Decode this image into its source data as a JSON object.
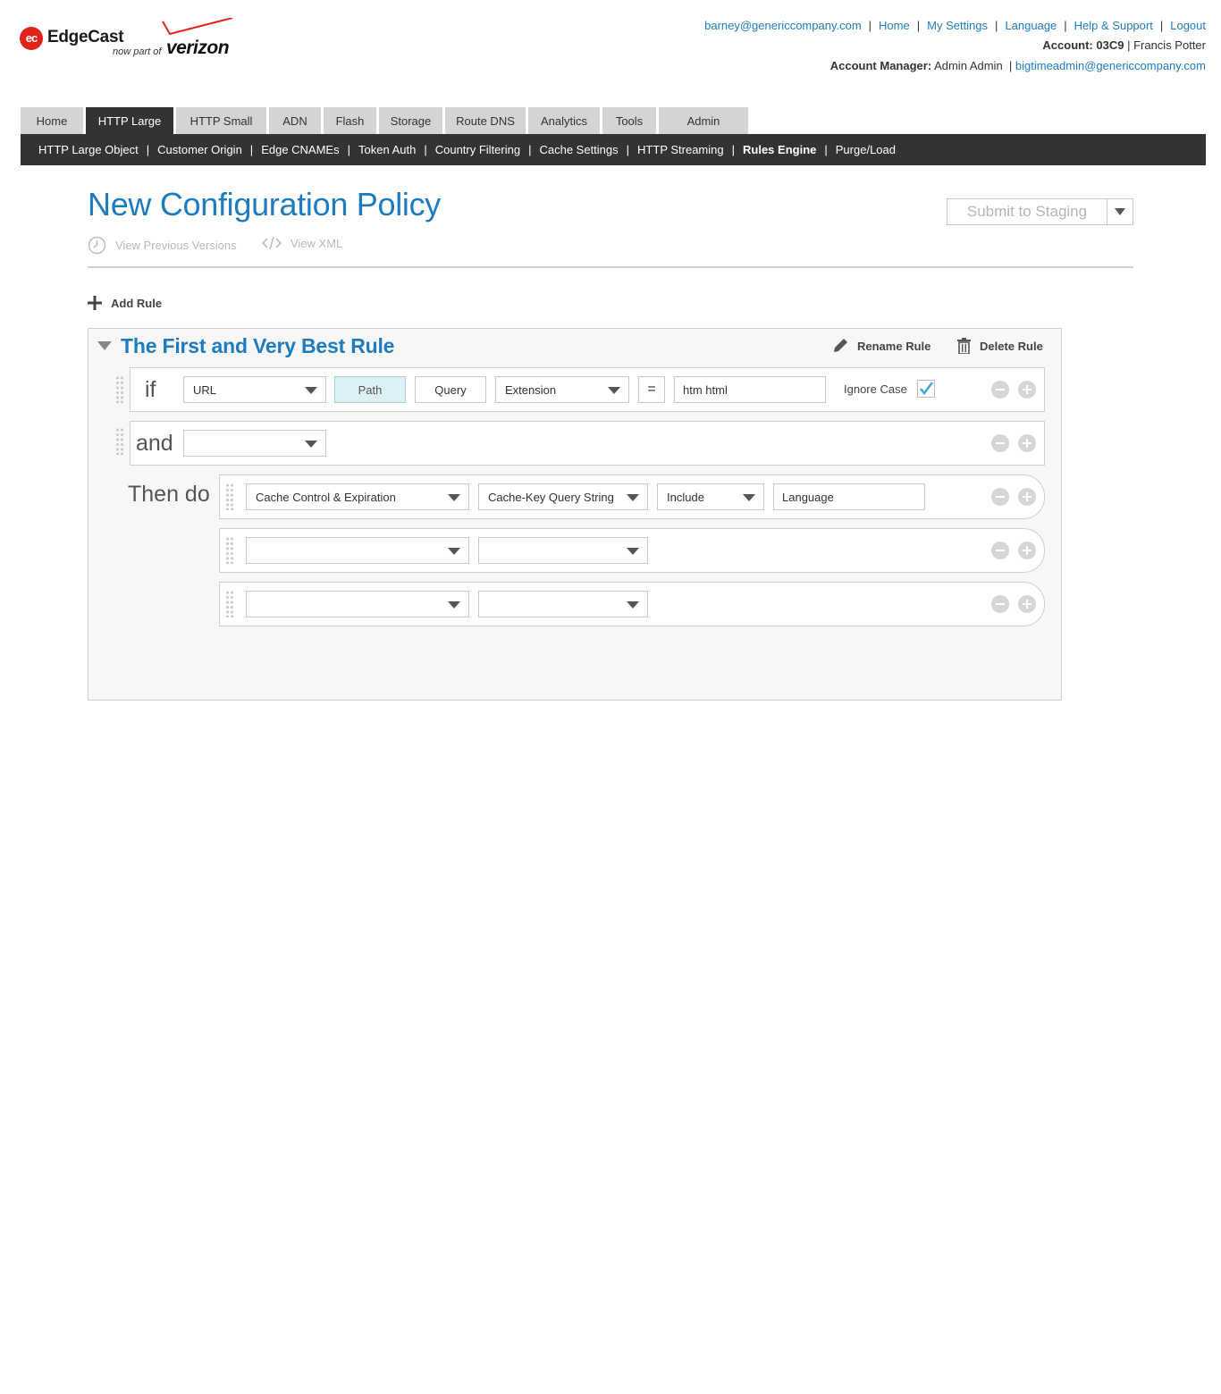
{
  "brand": {
    "logo_mark": "ec",
    "name": "EdgeCast",
    "tagline": "now part of",
    "parent": "verizon"
  },
  "header": {
    "links": [
      "barney@genericcompany.com",
      "Home",
      "My Settings",
      "Language",
      "Help & Support",
      "Logout"
    ],
    "account_label": "Account:",
    "account_id": "03C9",
    "account_user": "Francis Potter",
    "manager_label": "Account Manager:",
    "manager_name": "Admin Admin",
    "manager_email": "bigtimeadmin@genericcompany.com"
  },
  "tabs": [
    {
      "label": "Home",
      "active": false
    },
    {
      "label": "HTTP Large",
      "active": true
    },
    {
      "label": "HTTP Small",
      "active": false
    },
    {
      "label": "ADN",
      "active": false
    },
    {
      "label": "Flash",
      "active": false
    },
    {
      "label": "Storage",
      "active": false
    },
    {
      "label": "Route DNS",
      "active": false
    },
    {
      "label": "Analytics",
      "active": false
    },
    {
      "label": "Tools",
      "active": false
    },
    {
      "label": "Admin",
      "active": false
    }
  ],
  "subnav": [
    {
      "label": "HTTP Large Object",
      "current": false
    },
    {
      "label": "Customer Origin",
      "current": false
    },
    {
      "label": "Edge CNAMEs",
      "current": false
    },
    {
      "label": "Token Auth",
      "current": false
    },
    {
      "label": "Country Filtering",
      "current": false
    },
    {
      "label": "Cache Settings",
      "current": false
    },
    {
      "label": "HTTP Streaming",
      "current": false
    },
    {
      "label": "Rules Engine",
      "current": true
    },
    {
      "label": "Purge/Load",
      "current": false
    }
  ],
  "page": {
    "title": "New Configuration Policy",
    "submit_label": "Submit to Staging",
    "view_versions": "View Previous Versions",
    "view_xml": "View XML",
    "add_rule": "Add Rule"
  },
  "rule": {
    "title": "The First and Very Best Rule",
    "rename": "Rename Rule",
    "delete": "Delete Rule",
    "if_keyword": "if",
    "and_keyword": "and",
    "then_keyword": "Then do",
    "if_row": {
      "match_type": "URL",
      "path": "Path",
      "query": "Query",
      "component": "Extension",
      "operator": "=",
      "value": "htm html",
      "ignore_case_label": "Ignore Case",
      "ignore_case_checked": true
    },
    "and_row": {
      "match_type": ""
    },
    "actions": [
      {
        "category": "Cache Control & Expiration",
        "feature": "Cache-Key Query String",
        "mode": "Include",
        "value": "Language"
      },
      {
        "category": "",
        "feature": ""
      },
      {
        "category": "",
        "feature": ""
      }
    ]
  },
  "colors": {
    "accent_blue": "#1e7bbf",
    "nav_dark": "#333333",
    "tab_gray": "#d4d4d4",
    "path_selected": "#dcf0f6",
    "logo_red": "#e2231a"
  }
}
